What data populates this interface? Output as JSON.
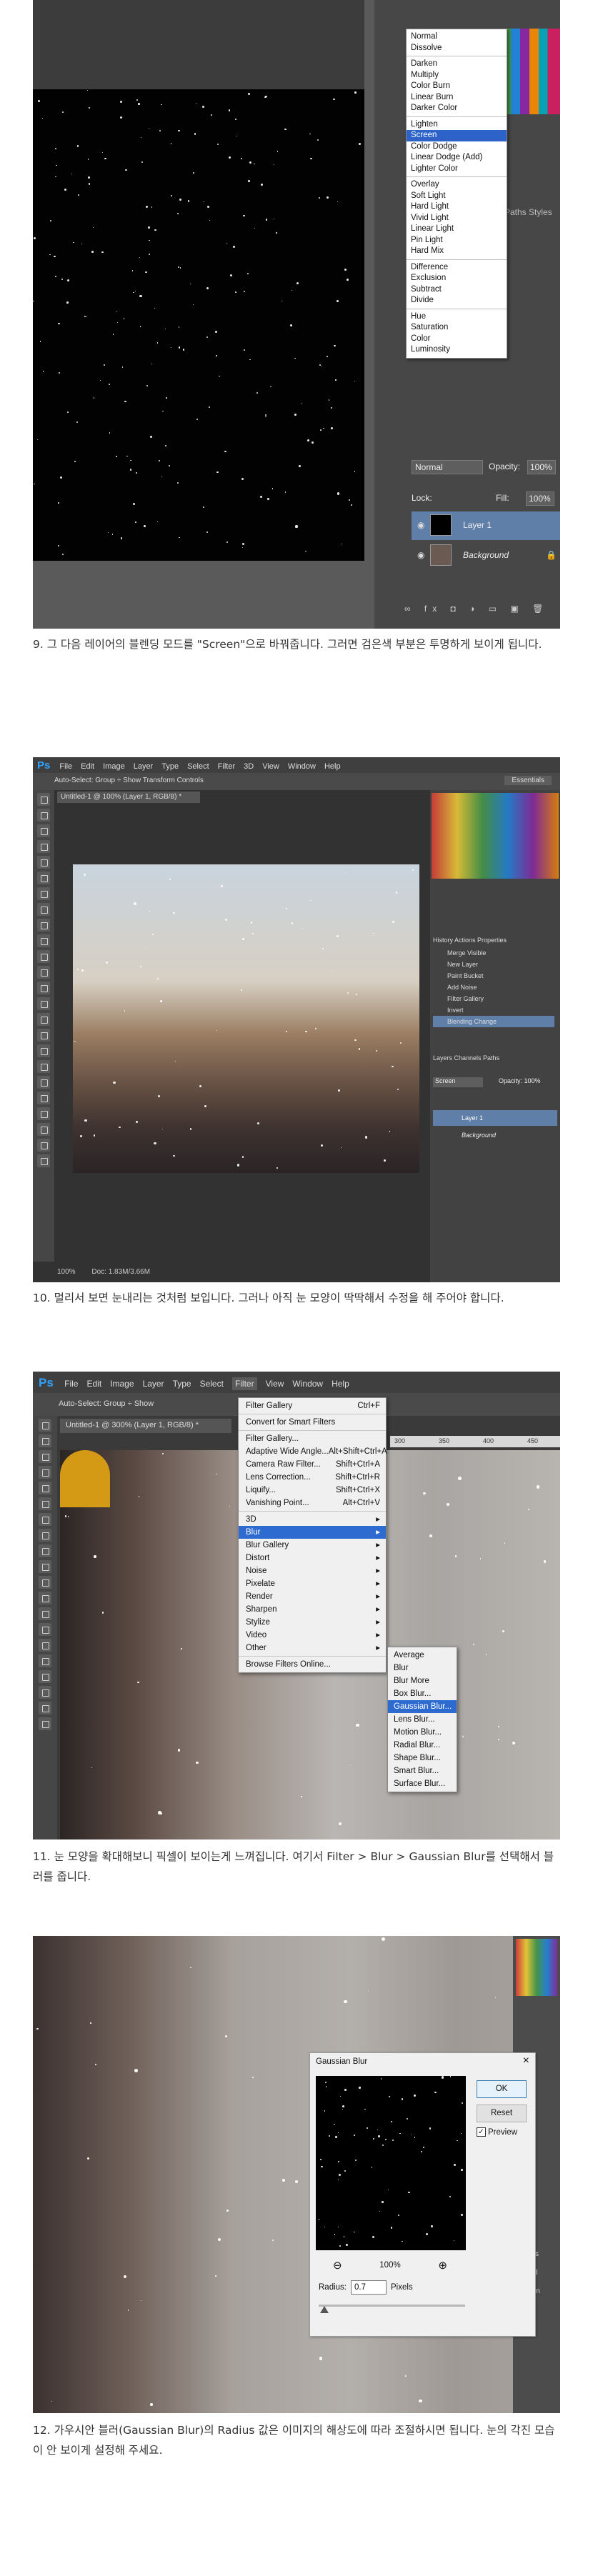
{
  "step9": {
    "caption": "9. 그 다음 레이어의 블렌딩 모드를 \"Screen\"으로 바꿔줍니다. 그러면 검은색 부분은 투명하게 보이게 됩니다.",
    "blend_groups": [
      [
        "Normal",
        "Dissolve"
      ],
      [
        "Darken",
        "Multiply",
        "Color Burn",
        "Linear Burn",
        "Darker Color"
      ],
      [
        "Lighten",
        "Screen",
        "Color Dodge",
        "Linear Dodge (Add)",
        "Lighter Color"
      ],
      [
        "Overlay",
        "Soft Light",
        "Hard Light",
        "Vivid Light",
        "Linear Light",
        "Pin Light",
        "Hard Mix"
      ],
      [
        "Difference",
        "Exclusion",
        "Subtract",
        "Divide"
      ],
      [
        "Hue",
        "Saturation",
        "Color",
        "Luminosity"
      ]
    ],
    "selected_mode": "Screen",
    "panel_tabs": "Paths  Styles",
    "mode_field": "Normal",
    "opacity_label": "Opacity:",
    "opacity_value": "100%",
    "lock_label": "Lock:",
    "fill_label": "Fill:",
    "fill_value": "100%",
    "layer1": "Layer 1",
    "background_layer": "Background",
    "bottom_icons": "∞ fx ◘ ◑ ▭ ▣ 🗑"
  },
  "step10": {
    "caption": "10. 멀리서 보면 눈내리는 것처럼 보입니다. 그러나 아직 눈 모양이 딱딱해서 수정을 해 주어야 합니다.",
    "logo": "Ps",
    "menu": [
      "File",
      "Edit",
      "Image",
      "Layer",
      "Type",
      "Select",
      "Filter",
      "3D",
      "View",
      "Window",
      "Help"
    ],
    "options_bar": "Auto-Select:  Group  ÷   Show Transform Controls",
    "workspace": "Essentials",
    "doc_tab": "Untitled-1 @ 100% (Layer 1, RGB/8) *",
    "status_zoom": "100%",
    "status_doc": "Doc: 1.83M/3.66M",
    "history_tabs": "History  Actions  Properties",
    "history_items": [
      "Merge Visible",
      "New Layer",
      "Paint Bucket",
      "Add Noise",
      "Filter Gallery",
      "Invert",
      "Blending Change"
    ],
    "layers_tabs": "Layers  Channels  Paths",
    "mode_field": "Screen",
    "opacity": "Opacity: 100%",
    "layer1": "Layer 1",
    "background_layer": "Background"
  },
  "step11": {
    "caption": "11. 눈 모양을 확대해보니 픽셀이 보이는게 느껴집니다. 여기서 Filter > Blur > Gaussian Blur를 선택해서 블러를 줍니다.",
    "logo": "Ps",
    "menu": [
      "File",
      "Edit",
      "Image",
      "Layer",
      "Type",
      "Select",
      "Filter",
      "View",
      "Window",
      "Help"
    ],
    "options_bar": "Auto-Select:   Group   ÷   Show",
    "doc_tab": "Untitled-1 @ 300% (Layer 1, RGB/8) *",
    "ruler": [
      "300",
      "350",
      "400",
      "450"
    ],
    "filter_groups": [
      [
        {
          "label": "Filter Gallery",
          "shortcut": "Ctrl+F"
        }
      ],
      [
        {
          "label": "Convert for Smart Filters",
          "shortcut": ""
        }
      ],
      [
        {
          "label": "Filter Gallery...",
          "shortcut": ""
        },
        {
          "label": "Adaptive Wide Angle...",
          "shortcut": "Alt+Shift+Ctrl+A"
        },
        {
          "label": "Camera Raw Filter...",
          "shortcut": "Shift+Ctrl+A"
        },
        {
          "label": "Lens Correction...",
          "shortcut": "Shift+Ctrl+R"
        },
        {
          "label": "Liquify...",
          "shortcut": "Shift+Ctrl+X"
        },
        {
          "label": "Vanishing Point...",
          "shortcut": "Alt+Ctrl+V"
        }
      ],
      [
        {
          "label": "3D",
          "shortcut": "▸"
        },
        {
          "label": "Blur",
          "shortcut": "▸"
        },
        {
          "label": "Blur Gallery",
          "shortcut": "▸"
        },
        {
          "label": "Distort",
          "shortcut": "▸"
        },
        {
          "label": "Noise",
          "shortcut": "▸"
        },
        {
          "label": "Pixelate",
          "shortcut": "▸"
        },
        {
          "label": "Render",
          "shortcut": "▸"
        },
        {
          "label": "Sharpen",
          "shortcut": "▸"
        },
        {
          "label": "Stylize",
          "shortcut": "▸"
        },
        {
          "label": "Video",
          "shortcut": "▸"
        },
        {
          "label": "Other",
          "shortcut": "▸"
        }
      ],
      [
        {
          "label": "Browse Filters Online...",
          "shortcut": ""
        }
      ]
    ],
    "highlighted_filter": "Blur",
    "blur_submenu": [
      "Average",
      "Blur",
      "Blur More",
      "Box Blur...",
      "Gaussian Blur...",
      "Lens Blur...",
      "Motion Blur...",
      "Radial Blur...",
      "Shape Blur...",
      "Smart Blur...",
      "Surface Blur..."
    ],
    "highlighted_blur": "Gaussian Blur..."
  },
  "step12": {
    "caption": "12. 가우시안 블러(Gaussian Blur)의 Radius 값은 이미지의 해상도에 따라 조절하시면 됩니다. 눈의 각진 모습이 안 보이게 설정해 주세요.",
    "dialog_title": "Gaussian Blur",
    "close": "×",
    "ok": "OK",
    "reset": "Reset",
    "preview_check": "✓",
    "preview": "Preview",
    "zoom_out": "⊖",
    "zoom_pct": "100%",
    "zoom_in": "⊕",
    "radius_label": "Radius:",
    "radius_value": "0.7",
    "radius_unit": "Pixels",
    "side_labels": [
      "Layers",
      "ρ Kind",
      "Screen"
    ]
  }
}
